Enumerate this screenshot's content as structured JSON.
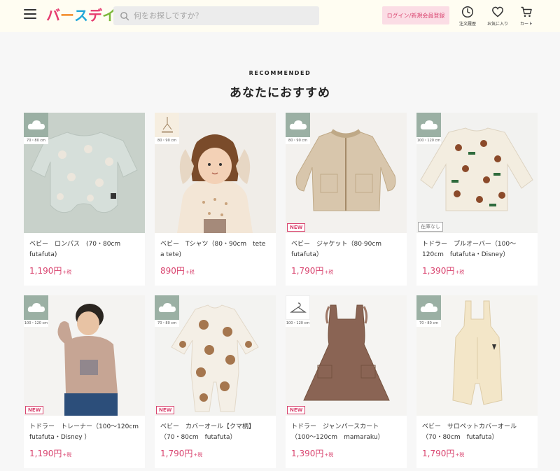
{
  "header": {
    "logo": {
      "letters": [
        "バ",
        "ー",
        "ス",
        "デ",
        "イ"
      ],
      "colors": [
        "#e63b6f",
        "#f28c28",
        "#22a7d8",
        "#e63b6f",
        "#7bb83a"
      ]
    },
    "search_placeholder": "何をお探しですか？",
    "login_label": "ログイン/新規会員登録",
    "history_label": "注文履歴",
    "favorites_label": "お気に入り",
    "cart_label": "カート"
  },
  "section": {
    "subtitle": "RECOMMENDED",
    "title": "あなたにおすすめ"
  },
  "colors": {
    "accent": "#d9446f",
    "login_bg": "#fbdde5",
    "header_bg": "#fffdf2"
  },
  "products": [
    {
      "name": "ベビー　ロンパス　(70・80cm　futafuta)",
      "price": "1,190円",
      "tax": "+税",
      "size": "70・80 cm",
      "tag": "",
      "brand": "futafuta",
      "image": "mint-romper"
    },
    {
      "name": "ベビー　Tシャツ（80・90cm　tete a tete)",
      "price": "890円",
      "tax": "+税",
      "size": "80・90 cm",
      "tag": "",
      "brand": "tete-a-tete",
      "image": "girl-bunny-hat"
    },
    {
      "name": "ベビー　ジャケット（80·90cm　futafuta）",
      "price": "1,790円",
      "tax": "+税",
      "size": "80・90 cm",
      "tag": "NEW",
      "brand": "futafuta",
      "image": "fleece-jacket"
    },
    {
      "name": "トドラー　プルオーバー（100〜120cm　futafuta・Disney）",
      "price": "1,390円",
      "tax": "+税",
      "size": "100・120 cm",
      "tag": "在庫なし",
      "brand": "futafuta",
      "image": "pooh-sweater"
    },
    {
      "name": "トドラー　トレーナー（100〜120cm　futafuta・Disney ）",
      "price": "1,190円",
      "tax": "+税",
      "size": "100・120 cm",
      "tag": "NEW",
      "brand": "futafuta",
      "image": "boy-sweatshirt"
    },
    {
      "name": "ベビー　カバーオール【クマ柄】（70・80cm　futafuta）",
      "price": "1,790円",
      "tax": "+税",
      "size": "70・80 cm",
      "tag": "NEW",
      "brand": "futafuta",
      "image": "bear-coverall"
    },
    {
      "name": "トドラー　ジャンパースカート（100〜120cm　mamaraku）",
      "price": "1,390円",
      "tax": "+税",
      "size": "100・120 cm",
      "tag": "NEW",
      "brand": "mamaraku",
      "image": "brown-jumper-skirt"
    },
    {
      "name": "ベビー　サロペットカバーオール（70・80cm　futafuta）",
      "price": "1,790円",
      "tax": "+税",
      "size": "70・80 cm",
      "tag": "",
      "brand": "futafuta",
      "image": "cream-overalls"
    }
  ]
}
